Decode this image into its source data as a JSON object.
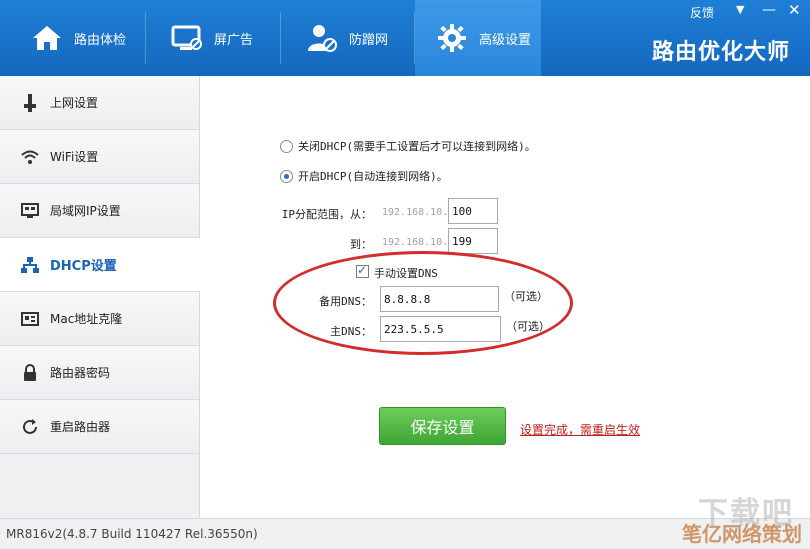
{
  "header": {
    "nav": [
      {
        "label": "路由体检",
        "icon": "home-icon"
      },
      {
        "label": "屏广告",
        "icon": "monitor-icon"
      },
      {
        "label": "防蹭网",
        "icon": "user-block-icon"
      },
      {
        "label": "高级设置",
        "icon": "gear-icon"
      }
    ],
    "active_nav": "高级设置",
    "brand": "路由优化大师",
    "feedback": "反馈",
    "accent_color": "#1a72cc"
  },
  "sidebar": {
    "items": [
      {
        "label": "上网设置",
        "icon": "plug-icon"
      },
      {
        "label": "WiFi设置",
        "icon": "wifi-icon"
      },
      {
        "label": "局域网IP设置",
        "icon": "lan-icon"
      },
      {
        "label": "DHCP设置",
        "icon": "network-tree-icon"
      },
      {
        "label": "Mac地址克隆",
        "icon": "card-icon"
      },
      {
        "label": "路由器密码",
        "icon": "lock-icon"
      },
      {
        "label": "重启路由器",
        "icon": "refresh-icon"
      }
    ],
    "active": "DHCP设置"
  },
  "dhcp": {
    "option_off": "关闭DHCP(需要手工设置后才可以连接到网络)。",
    "option_on": "开启DHCP(自动连接到网络)。",
    "selected": "on",
    "range_label": "IP分配范围，从：",
    "to_label": "到：",
    "ip_prefix": "192.168.10.",
    "range_start": "100",
    "range_end": "199",
    "manual_dns_label": "手动设置DNS",
    "manual_dns_checked": true,
    "backup_dns_label": "备用DNS：",
    "backup_dns_value": "8.8.8.8",
    "primary_dns_label": "主DNS：",
    "primary_dns_value": "223.5.5.5",
    "optional_label": "（可选）",
    "save_label": "保存设置",
    "notice": "设置完成，需重启生效"
  },
  "status": {
    "version": "MR816v2(4.8.7 Build 110427 Rel.36550n)"
  },
  "watermark": {
    "line1": "下载吧",
    "line2": "笔亿网络策划"
  }
}
